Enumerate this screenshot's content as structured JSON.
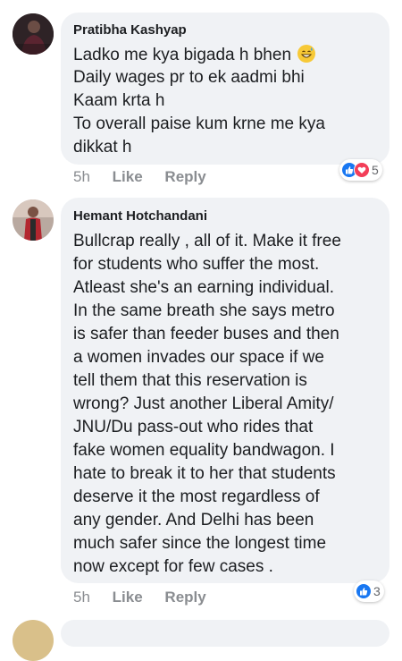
{
  "comments": [
    {
      "author": "Pratibha Kashyap",
      "lines": [
        "Ladko me kya bigada h bhen",
        "Daily wages pr to ek aadmi bhi",
        "Kaam krta h",
        "To overall paise kum krne me kya",
        "dikkat h"
      ],
      "emoji": "grinning-sweat-emoji",
      "time": "5h",
      "like_label": "Like",
      "reply_label": "Reply",
      "reaction_count": "5",
      "reactions": [
        "like",
        "love"
      ]
    },
    {
      "author": "Hemant Hotchandani",
      "lines": [
        "Bullcrap really , all of it. Make it free",
        "for students who suffer the most.",
        "Atleast she's an  earning individual.",
        "In the same breath she says  metro",
        "is safer than feeder buses and then",
        "a women invades our space if we",
        "tell them that this reservation is",
        "wrong? Just another Liberal Amity/",
        "JNU/Du pass-out who rides that",
        "fake women equality bandwagon. I",
        "hate to break it to her that students",
        "deserve it the most regardless of",
        "any gender. And Delhi has been",
        "much safer since the longest time",
        "now except for few cases ."
      ],
      "time": "5h",
      "like_label": "Like",
      "reply_label": "Reply",
      "reaction_count": "3",
      "reactions": [
        "like"
      ]
    }
  ],
  "colors": {
    "bubble": "#f0f2f5",
    "meta": "#8a8d91",
    "like_blue": "#1877f2",
    "love_red": "#f33e58"
  }
}
